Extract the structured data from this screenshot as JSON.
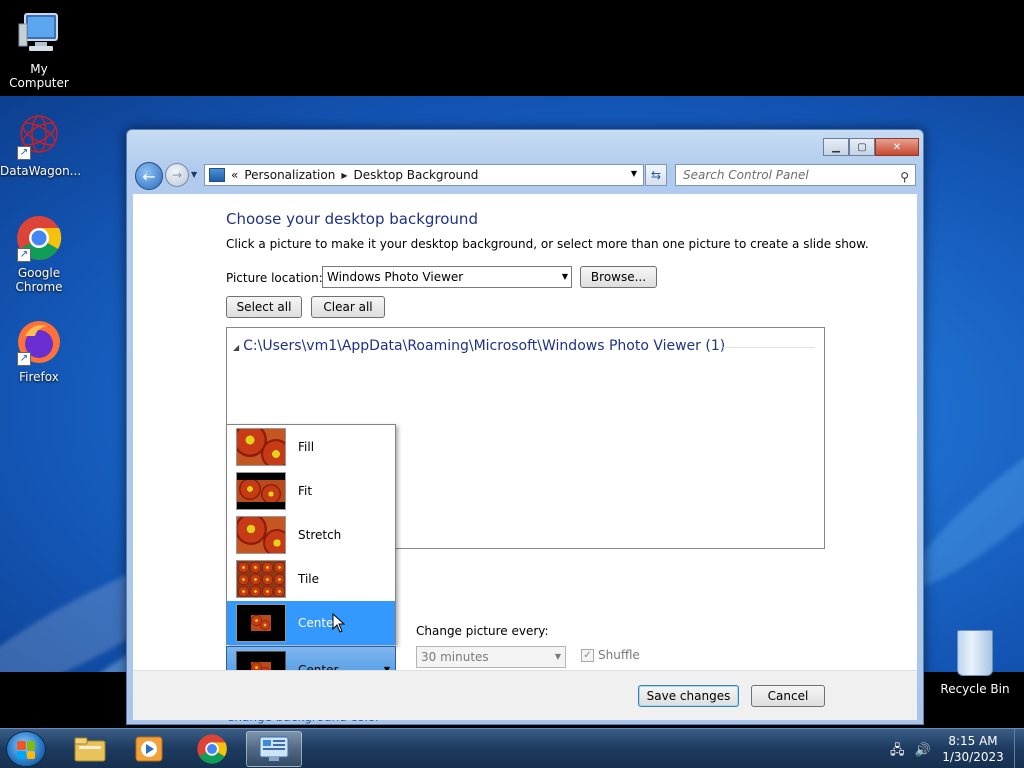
{
  "desktop": {
    "icons": [
      {
        "label": "My Computer"
      },
      {
        "label": "DataWagon..."
      },
      {
        "label": "Google Chrome"
      },
      {
        "label": "Firefox"
      },
      {
        "label": "Recycle Bin"
      }
    ]
  },
  "window": {
    "address": {
      "crumbs": [
        "Personalization",
        "Desktop Background"
      ],
      "back_glyph": "«"
    },
    "search": {
      "placeholder": "Search Control Panel"
    },
    "content": {
      "title": "Choose your desktop background",
      "subtitle": "Click a picture to make it your desktop background, or select more than one picture to create a slide show.",
      "picture_location_label": "Picture location:",
      "picture_location_value": "Windows Photo Viewer",
      "browse_label": "Browse...",
      "select_all_label": "Select all",
      "clear_all_label": "Clear all",
      "folder_path": "C:\\Users\\vm1\\AppData\\Roaming\\Microsoft\\Windows Photo Viewer (1)",
      "picture_position": {
        "options": [
          "Fill",
          "Fit",
          "Stretch",
          "Tile",
          "Center"
        ],
        "selected": "Center"
      },
      "change_every_label": "Change picture every:",
      "change_every_value": "30 minutes",
      "shuffle_label": "Shuffle",
      "change_bg_color_label": "Change background color"
    },
    "footer": {
      "save_label": "Save changes",
      "cancel_label": "Cancel"
    }
  },
  "taskbar": {
    "time": "8:15 AM",
    "date": "1/30/2023"
  },
  "colors": {
    "accent": "#3399ff",
    "title": "#1e3287",
    "link": "#1f5fa8"
  }
}
